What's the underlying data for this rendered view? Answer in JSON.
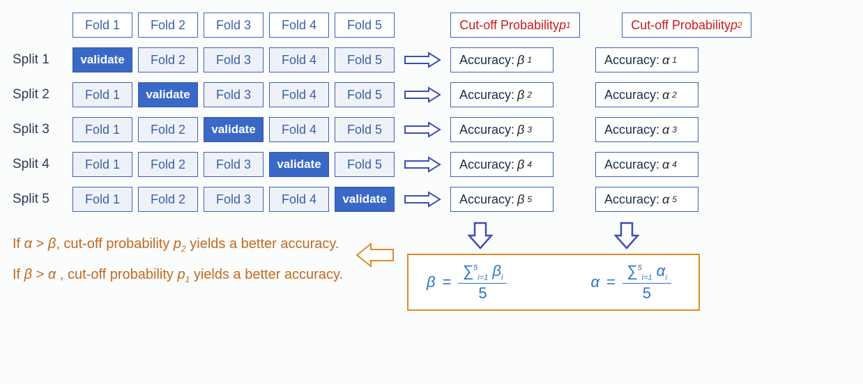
{
  "headerFolds": [
    "Fold 1",
    "Fold 2",
    "Fold 3",
    "Fold 4",
    "Fold 5"
  ],
  "splits": [
    {
      "label": "Split 1",
      "cells": [
        "validate",
        "Fold 2",
        "Fold 3",
        "Fold 4",
        "Fold 5"
      ],
      "validateIdx": 0
    },
    {
      "label": "Split 2",
      "cells": [
        "Fold 1",
        "validate",
        "Fold 3",
        "Fold 4",
        "Fold 5"
      ],
      "validateIdx": 1
    },
    {
      "label": "Split 3",
      "cells": [
        "Fold 1",
        "Fold 2",
        "validate",
        "Fold 4",
        "Fold 5"
      ],
      "validateIdx": 2
    },
    {
      "label": "Split 4",
      "cells": [
        "Fold 1",
        "Fold 2",
        "Fold 3",
        "validate",
        "Fold 5"
      ],
      "validateIdx": 3
    },
    {
      "label": "Split 5",
      "cells": [
        "Fold 1",
        "Fold 2",
        "Fold 3",
        "Fold 4",
        "validate"
      ],
      "validateIdx": 4
    }
  ],
  "cutoff1": {
    "prefix": "Cut-off Probability ",
    "sym": "p",
    "sub": "1"
  },
  "cutoff2": {
    "prefix": "Cut-off Probability ",
    "sym": "p",
    "sub": "2"
  },
  "accLabel": "Accuracy: ",
  "beta": "β",
  "alpha": "α",
  "subs": [
    "1",
    "2",
    "3",
    "4",
    "5"
  ],
  "formulaBeta": {
    "lhs": "β",
    "eq": " = ",
    "sumTop": "5",
    "sumBot": "i=1",
    "sumSym": "β",
    "sumSub": "i",
    "den": "5"
  },
  "formulaAlpha": {
    "lhs": "α",
    "eq": " = ",
    "sumTop": "5",
    "sumBot": "i=1",
    "sumSym": "α",
    "sumSub": "i",
    "den": "5"
  },
  "concl1": {
    "pre": "If ",
    "a": "α",
    "gt": " > ",
    "b": "β",
    "mid": ", cut-off probability ",
    "p": "p",
    "psub": "2",
    "post": " yields a better accuracy."
  },
  "concl2": {
    "pre": "If ",
    "a": "β",
    "gt": " > ",
    "b": "α",
    "mid": " , cut-off probability ",
    "p": "p",
    "psub": "1",
    "post": " yields a better accuracy."
  }
}
